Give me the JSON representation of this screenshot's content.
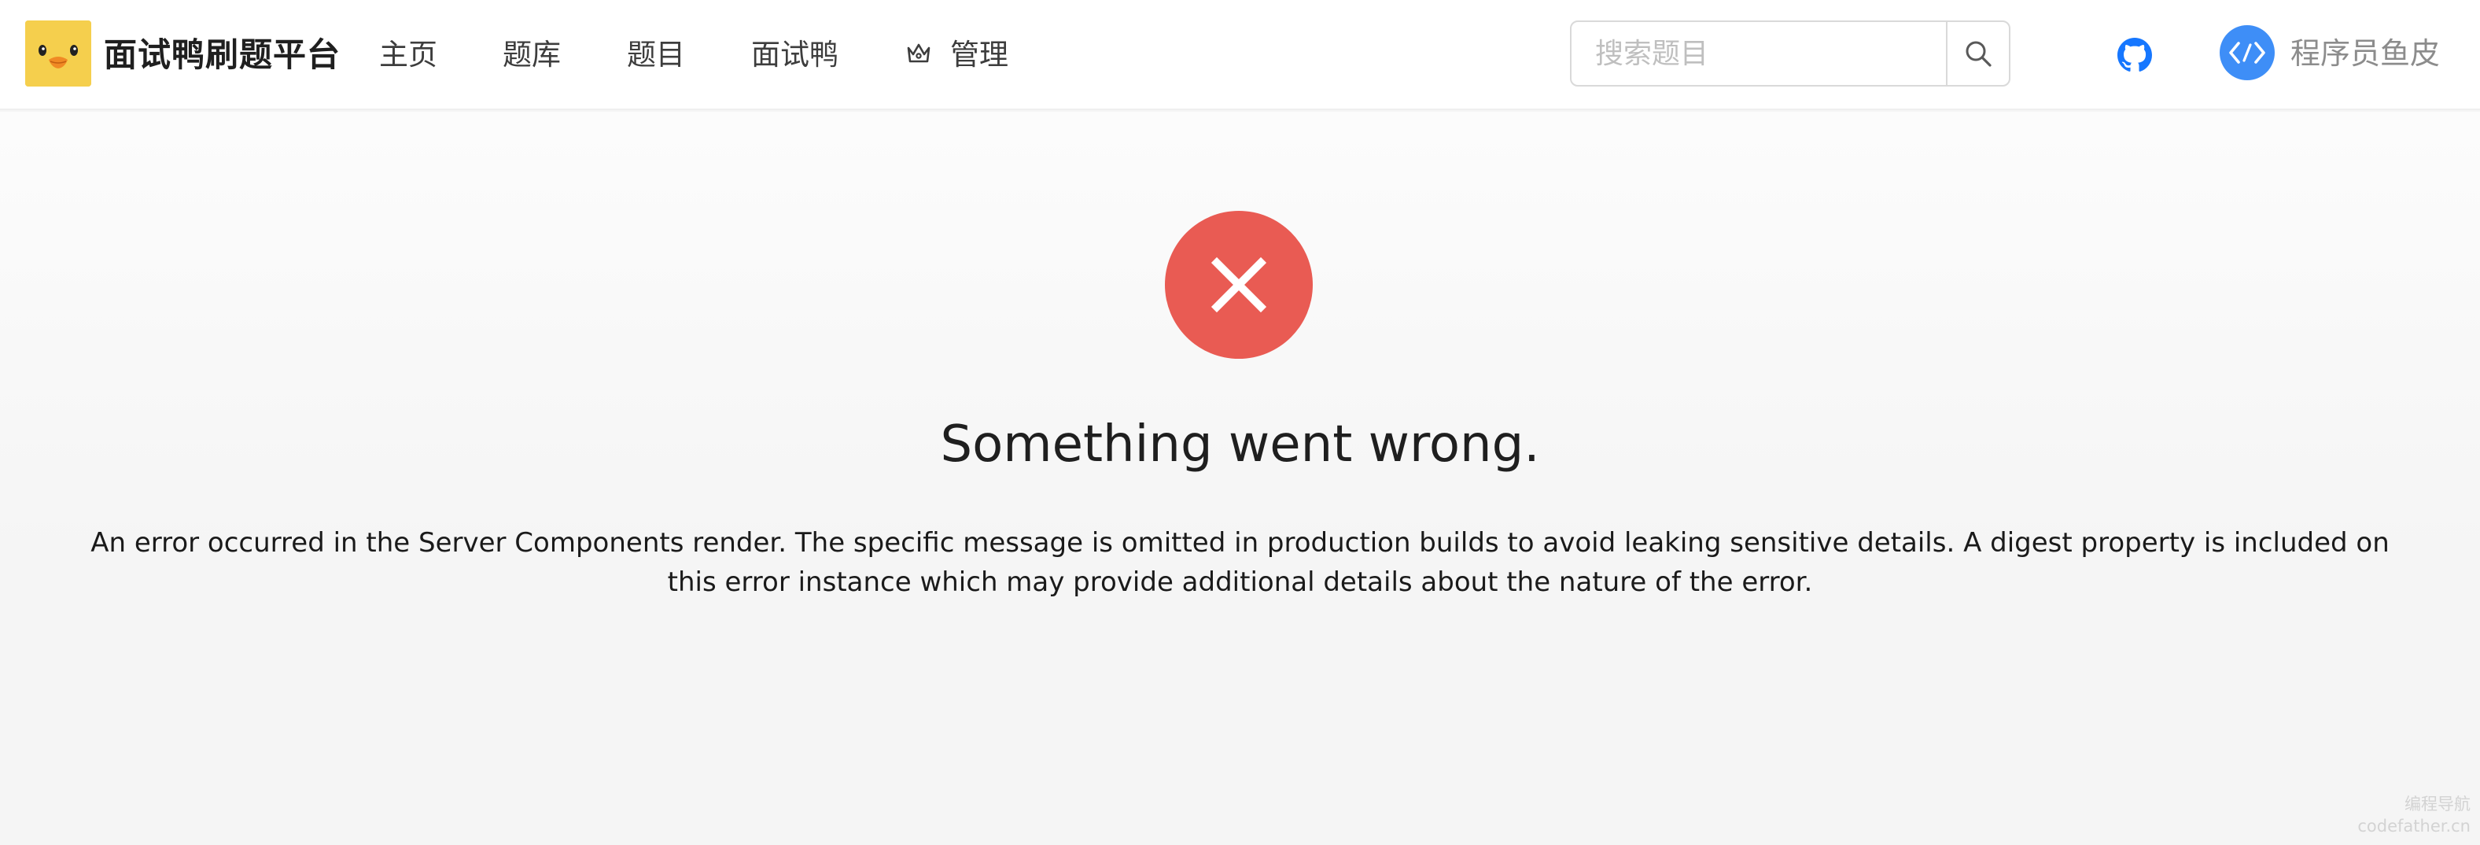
{
  "header": {
    "brand_title": "面试鸭刷题平台",
    "nav": {
      "home": "主页",
      "bank": "题库",
      "questions": "题目",
      "interview_duck": "面试鸭",
      "admin": "管理"
    },
    "search": {
      "placeholder": "搜索题目"
    },
    "user": {
      "name": "程序员鱼皮"
    }
  },
  "error": {
    "title": "Something went wrong.",
    "message": "An error occurred in the Server Components render. The specific message is omitted in production builds to avoid leaking sensitive details. A digest property is included on this error instance which may provide additional details about the nature of the error."
  },
  "watermark": {
    "line1": "编程导航",
    "line2": "codefather.cn"
  },
  "colors": {
    "logo_bg": "#f5cf4d",
    "error_red": "#e95b53",
    "avatar_blue": "#3e8ef7",
    "github_blue": "#1677ff"
  }
}
